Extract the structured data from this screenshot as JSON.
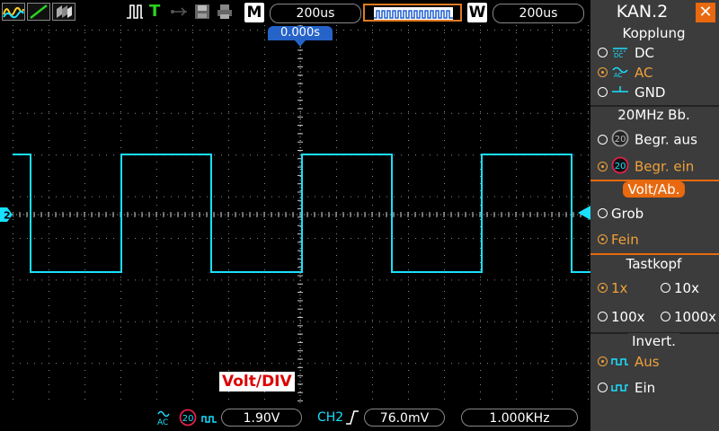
{
  "topbar": {
    "mode_letter": "M",
    "timebase": "200us",
    "window_letter": "W",
    "window_timebase": "200us"
  },
  "screen": {
    "trigger_time": "0.000s",
    "channel_number": "2",
    "volt_div_label": "Volt/DIV",
    "trace_color": "#19e0ff"
  },
  "bottombar": {
    "volts_per_div": "1.90V",
    "trigger_channel": "CH2",
    "trigger_level": "76.0mV",
    "frequency": "1.000KHz",
    "bw_limit_badge": "20"
  },
  "menu": {
    "title": "KAN.2",
    "close_icon": "close-icon",
    "coupling": {
      "title": "Kopplung",
      "options": [
        {
          "label": "DC",
          "selected": false,
          "icon": "dc-icon"
        },
        {
          "label": "AC",
          "selected": true,
          "icon": "ac-icon"
        },
        {
          "label": "GND",
          "selected": false,
          "icon": "gnd-icon"
        }
      ]
    },
    "bandwidth": {
      "title": "20MHz  Bb.",
      "badge": "20",
      "options": [
        {
          "label": "Begr.  aus",
          "selected": false
        },
        {
          "label": "Begr.  ein",
          "selected": true
        }
      ]
    },
    "voltdiv": {
      "title": "Volt/Ab.",
      "options": [
        {
          "label": "Grob",
          "selected": false
        },
        {
          "label": "Fein",
          "selected": true
        }
      ]
    },
    "probe": {
      "title": "Tastkopf",
      "options": [
        {
          "label": "1x",
          "selected": true
        },
        {
          "label": "10x",
          "selected": false
        },
        {
          "label": "100x",
          "selected": false
        },
        {
          "label": "1000x",
          "selected": false
        }
      ]
    },
    "invert": {
      "title": "Invert.",
      "options": [
        {
          "label": "Aus",
          "selected": true
        },
        {
          "label": "Ein",
          "selected": false
        }
      ]
    }
  },
  "colors": {
    "accent": "#e8690f",
    "selected_text": "#f0a23a",
    "trace": "#19e0ff",
    "menu_bg": "#3c3c3c"
  }
}
